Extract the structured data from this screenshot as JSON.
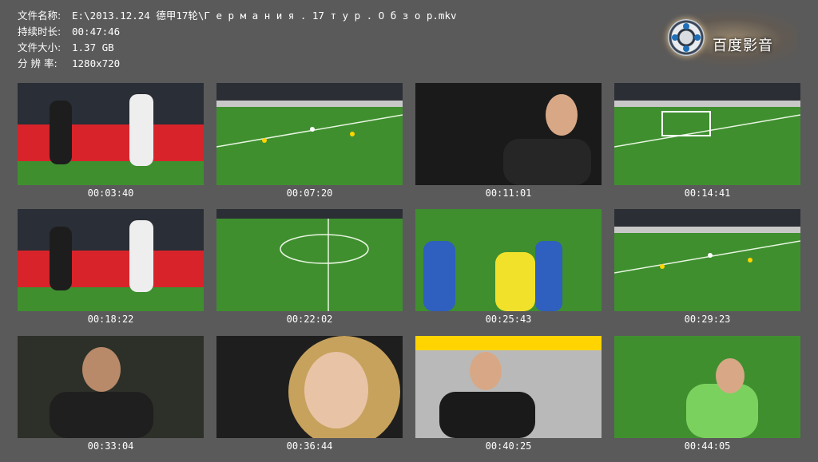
{
  "info": {
    "filename_label": "文件名称:",
    "filename_value": "E:\\2013.12.24 德甲17轮\\Г е р м а н и я . 17 т у р . О б з о р.mkv",
    "duration_label": "持续时长:",
    "duration_value": "00:47:46",
    "size_label": "文件大小:",
    "size_value": "1.37 GB",
    "resolution_label": "分 辨 率:",
    "resolution_value": "1280x720"
  },
  "logo": {
    "text": "百度影音",
    "icon": "film-reel-icon"
  },
  "thumbnails": [
    {
      "time": "00:03:40",
      "scene": "players-ad-boards"
    },
    {
      "time": "00:07:20",
      "scene": "pitch-wide"
    },
    {
      "time": "00:11:01",
      "scene": "coach-dark"
    },
    {
      "time": "00:14:41",
      "scene": "pitch-goal"
    },
    {
      "time": "00:18:22",
      "scene": "players-ad-boards"
    },
    {
      "time": "00:22:02",
      "scene": "pitch-center"
    },
    {
      "time": "00:25:43",
      "scene": "players-closeup"
    },
    {
      "time": "00:29:23",
      "scene": "pitch-wide"
    },
    {
      "time": "00:33:04",
      "scene": "coach-face"
    },
    {
      "time": "00:36:44",
      "scene": "woman-smiling"
    },
    {
      "time": "00:40:25",
      "scene": "coach-bench"
    },
    {
      "time": "00:44:05",
      "scene": "goalkeeper"
    }
  ],
  "colors": {
    "background": "#5a5a5a",
    "text": "#ffffff",
    "pitch": "#3f8f2f"
  }
}
